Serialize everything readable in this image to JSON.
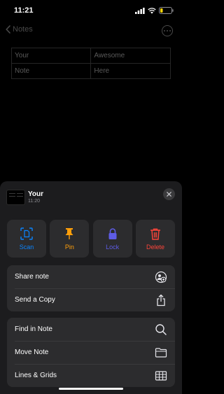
{
  "status": {
    "time": "11:21"
  },
  "nav": {
    "back_label": "Notes"
  },
  "table": {
    "rows": [
      [
        "Your",
        "Awesome"
      ],
      [
        "Note",
        "Here"
      ]
    ]
  },
  "sheet": {
    "note_title": "Your",
    "note_time": "11:20",
    "actions": [
      {
        "label": "Scan",
        "icon": "scan-icon",
        "color": "#0a84ff"
      },
      {
        "label": "Pin",
        "icon": "pin-icon",
        "color": "#ff9f0a"
      },
      {
        "label": "Lock",
        "icon": "lock-icon",
        "color": "#5e5ce6"
      },
      {
        "label": "Delete",
        "icon": "trash-icon",
        "color": "#ff453a"
      }
    ],
    "group1": [
      {
        "label": "Share note",
        "icon": "share-people-icon"
      },
      {
        "label": "Send a Copy",
        "icon": "share-icon"
      }
    ],
    "group2": [
      {
        "label": "Find in Note",
        "icon": "search-icon"
      },
      {
        "label": "Move Note",
        "icon": "folder-icon"
      },
      {
        "label": "Lines & Grids",
        "icon": "grid-icon"
      }
    ]
  }
}
